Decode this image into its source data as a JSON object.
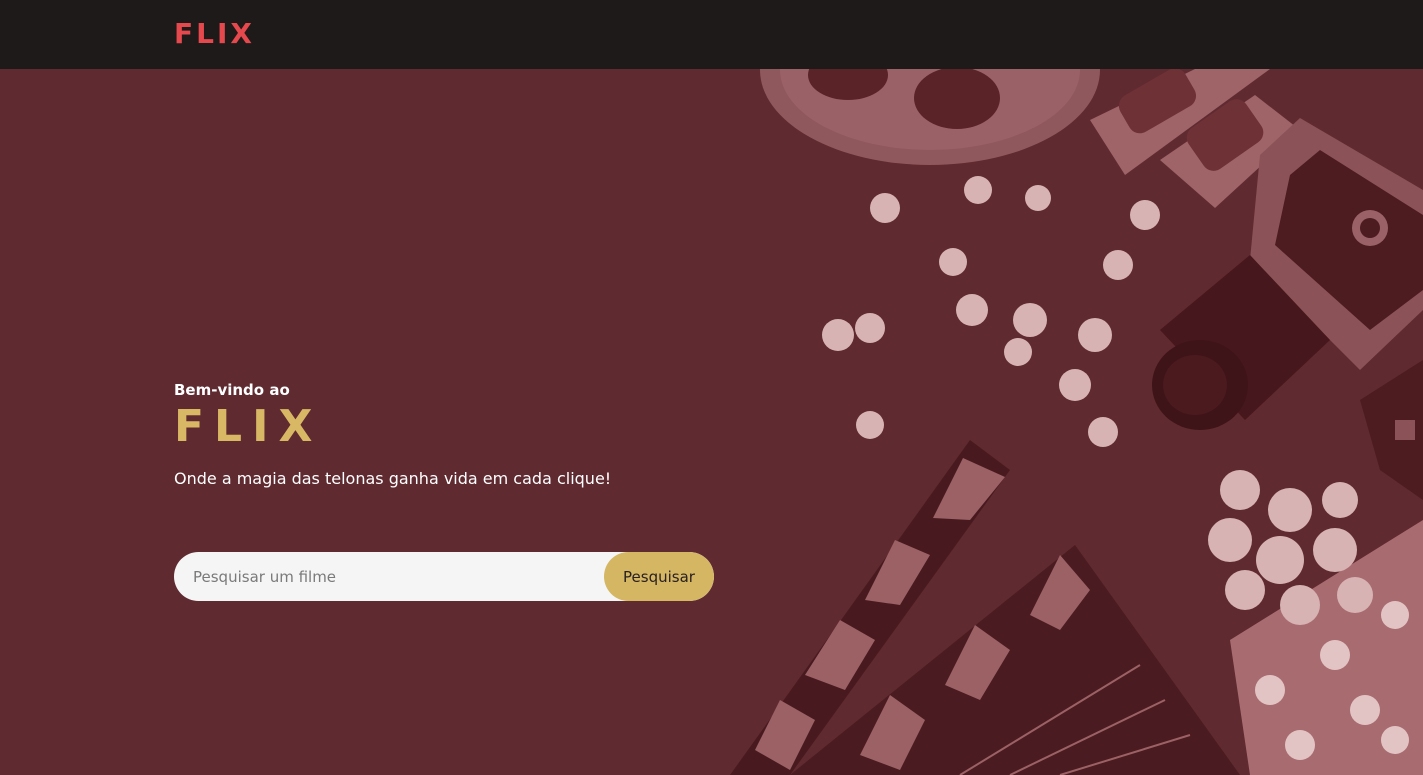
{
  "header": {
    "logo": "FLIX"
  },
  "hero": {
    "welcome": "Bem-vindo ao",
    "title": "FLIX",
    "tagline": "Onde a magia das telonas ganha vida em cada clique!",
    "search": {
      "placeholder": "Pesquisar um filme",
      "value": "",
      "button_label": "Pesquisar"
    },
    "background_icons": [
      "film-reel-icon",
      "3d-glasses-icon",
      "popcorn-icon",
      "movie-camera-icon",
      "clapperboard-icon",
      "popcorn-bucket-icon"
    ]
  },
  "colors": {
    "header_bg": "#1e1a1a",
    "hero_bg": "#5f2a30",
    "logo_red": "#e5484d",
    "title_gold": "#d8b864",
    "button_gold": "#d4b663",
    "input_bg": "#f5f5f5"
  }
}
